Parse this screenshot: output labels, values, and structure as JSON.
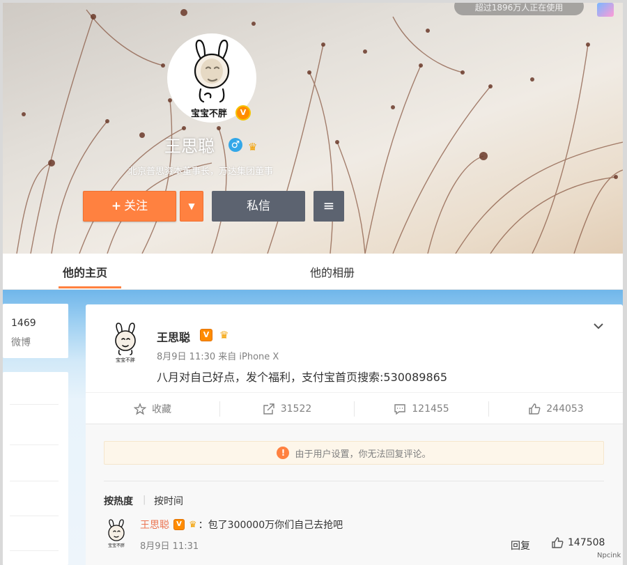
{
  "top_overlay": {
    "pill_text": "超过1896万人正在使用"
  },
  "profile": {
    "avatar_caption": "宝宝不胖",
    "avatar_badge": "V",
    "name": "王思聪",
    "gender_symbol": "♂",
    "title": "北京普思资本董事长，万达集团董事"
  },
  "buttons": {
    "follow_plus": "+",
    "follow": "关注",
    "follow_dropdown": "▼",
    "message": "私信",
    "menu": "≡"
  },
  "tabs": [
    {
      "label": "他的主页",
      "active": true
    },
    {
      "label": "他的相册",
      "active": false
    }
  ],
  "left_sidebar": {
    "count": "1469",
    "label": "微博"
  },
  "post": {
    "author": "王思聪",
    "verified_badge": "V",
    "crown": "♛",
    "meta": "8月9日 11:30 来自 iPhone X",
    "text": "八月对自己好点，发个福利，支付宝首页搜索:530089865",
    "actions": {
      "favorite": "收藏",
      "repost": "31522",
      "comment": "121455",
      "like": "244053"
    }
  },
  "comments": {
    "notice": "由于用户设置，你无法回复评论。",
    "notice_icon": "!",
    "sort_hot": "按热度",
    "sort_sep": "|",
    "sort_time": "按时间",
    "items": [
      {
        "author": "王思聪",
        "badge": "V",
        "text": "：包了300000万你们自己去抢吧",
        "date": "8月9日 11:31",
        "reply_label": "回复",
        "likes": "147508"
      }
    ]
  },
  "watermark": "Npcink",
  "colors": {
    "accent_orange": "#ff8140",
    "button_gray": "#5c6370",
    "comment_name": "#eb7350",
    "badge_orange": "#ff8c00"
  },
  "icons": [
    "gender-male-icon",
    "crown-icon",
    "chevron-down-icon",
    "star-icon",
    "share-icon",
    "comment-icon",
    "thumb-up-icon",
    "info-icon",
    "menu-icon"
  ]
}
